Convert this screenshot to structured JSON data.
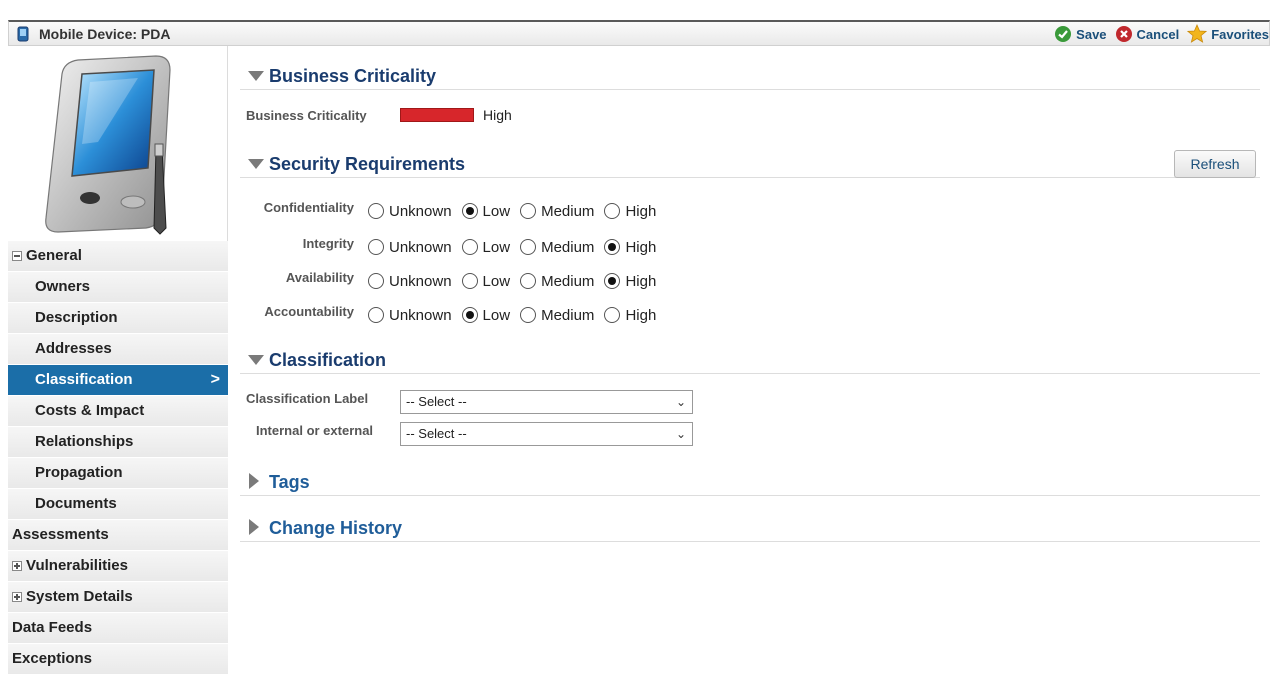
{
  "window": {
    "title": "Mobile Device: PDA",
    "actions": [
      {
        "label": "Save",
        "icon": "check-icon",
        "color": "#3a9a3a"
      },
      {
        "label": "Cancel",
        "icon": "cancel-icon",
        "color": "#c0282d"
      },
      {
        "label": "Favorites",
        "icon": "star-icon",
        "color": "#f2b51c"
      }
    ]
  },
  "sidebar": {
    "items": [
      {
        "label": "General",
        "kind": "top-collapse"
      },
      {
        "label": "Owners",
        "kind": "sub"
      },
      {
        "label": "Description",
        "kind": "sub"
      },
      {
        "label": "Addresses",
        "kind": "sub"
      },
      {
        "label": "Classification",
        "kind": "sub-active"
      },
      {
        "label": "Costs & Impact",
        "kind": "sub"
      },
      {
        "label": "Relationships",
        "kind": "sub"
      },
      {
        "label": "Propagation",
        "kind": "sub"
      },
      {
        "label": "Documents",
        "kind": "sub"
      },
      {
        "label": "Assessments",
        "kind": "top"
      },
      {
        "label": "Vulnerabilities",
        "kind": "top-expand"
      },
      {
        "label": "System Details",
        "kind": "top-expand"
      },
      {
        "label": "Data Feeds",
        "kind": "top"
      },
      {
        "label": "Exceptions",
        "kind": "top"
      }
    ],
    "active_chevron": ">"
  },
  "business_criticality": {
    "section_title": "Business Criticality",
    "field_label": "Business Criticality",
    "value": "High",
    "color": "#d7262b"
  },
  "security": {
    "section_title": "Security Requirements",
    "refresh_label": "Refresh",
    "options": [
      "Unknown",
      "Low",
      "Medium",
      "High"
    ],
    "rows": [
      {
        "label": "Confidentiality",
        "selected": "Low"
      },
      {
        "label": "Integrity",
        "selected": "High"
      },
      {
        "label": "Availability",
        "selected": "High"
      },
      {
        "label": "Accountability",
        "selected": "Low"
      }
    ]
  },
  "classification": {
    "section_title": "Classification",
    "fields": [
      {
        "label": "Classification Label",
        "value": "-- Select --"
      },
      {
        "label": "Internal or external",
        "value": "-- Select --"
      }
    ]
  },
  "collapsed_sections": [
    {
      "title": "Tags"
    },
    {
      "title": "Change History"
    }
  ]
}
